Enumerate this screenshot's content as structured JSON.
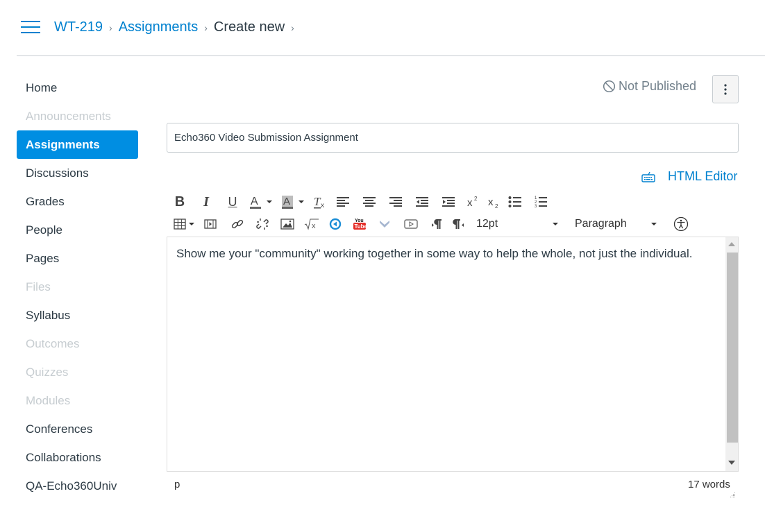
{
  "header": {
    "menu_icon": "hamburger-icon",
    "breadcrumb": [
      {
        "label": "WT-219",
        "link": true
      },
      {
        "label": "Assignments",
        "link": true
      },
      {
        "label": "Create new",
        "link": false
      }
    ],
    "separator": "›"
  },
  "sidebar": {
    "items": [
      {
        "label": "Home",
        "state": "normal"
      },
      {
        "label": "Announcements",
        "state": "disabled"
      },
      {
        "label": "Assignments",
        "state": "active"
      },
      {
        "label": "Discussions",
        "state": "normal"
      },
      {
        "label": "Grades",
        "state": "normal"
      },
      {
        "label": "People",
        "state": "normal"
      },
      {
        "label": "Pages",
        "state": "normal"
      },
      {
        "label": "Files",
        "state": "disabled"
      },
      {
        "label": "Syllabus",
        "state": "normal"
      },
      {
        "label": "Outcomes",
        "state": "disabled"
      },
      {
        "label": "Quizzes",
        "state": "disabled"
      },
      {
        "label": "Modules",
        "state": "disabled"
      },
      {
        "label": "Conferences",
        "state": "normal"
      },
      {
        "label": "Collaborations",
        "state": "normal"
      },
      {
        "label": "QA-Echo360Univ",
        "state": "normal"
      }
    ]
  },
  "publish": {
    "status_label": "Not Published",
    "status_icon": "unpublished-icon",
    "more_icon": "kebab-icon"
  },
  "form": {
    "title_value": "Echo360 Video Submission Assignment",
    "html_editor_label": "HTML Editor",
    "html_editor_icon": "keyboard-icon"
  },
  "toolbar": {
    "bold": "B",
    "italic": "I",
    "underline": "U",
    "font_size": "12pt",
    "block_format": "Paragraph",
    "buttons_row1": [
      "bold",
      "italic",
      "underline",
      "text-color",
      "background-color",
      "clear-formatting",
      "align-left",
      "align-center",
      "align-right",
      "outdent",
      "indent",
      "superscript",
      "subscript",
      "bullet-list",
      "numbered-list"
    ],
    "buttons_row2": [
      "table",
      "media",
      "link",
      "unlink",
      "image",
      "math-equation",
      "echo360",
      "youtube",
      "vimeo-like",
      "video-embed",
      "ltr",
      "rtl",
      "font-size",
      "format",
      "accessibility-checker"
    ]
  },
  "editor": {
    "content": "Show me your \"community\" working together in some way to help the whole, not just the individual.",
    "path": "p",
    "word_count": "17 words"
  },
  "colors": {
    "accent": "#008ee2",
    "link": "#0081cf",
    "text": "#2d3b45",
    "disabled": "#c7cdd1"
  }
}
